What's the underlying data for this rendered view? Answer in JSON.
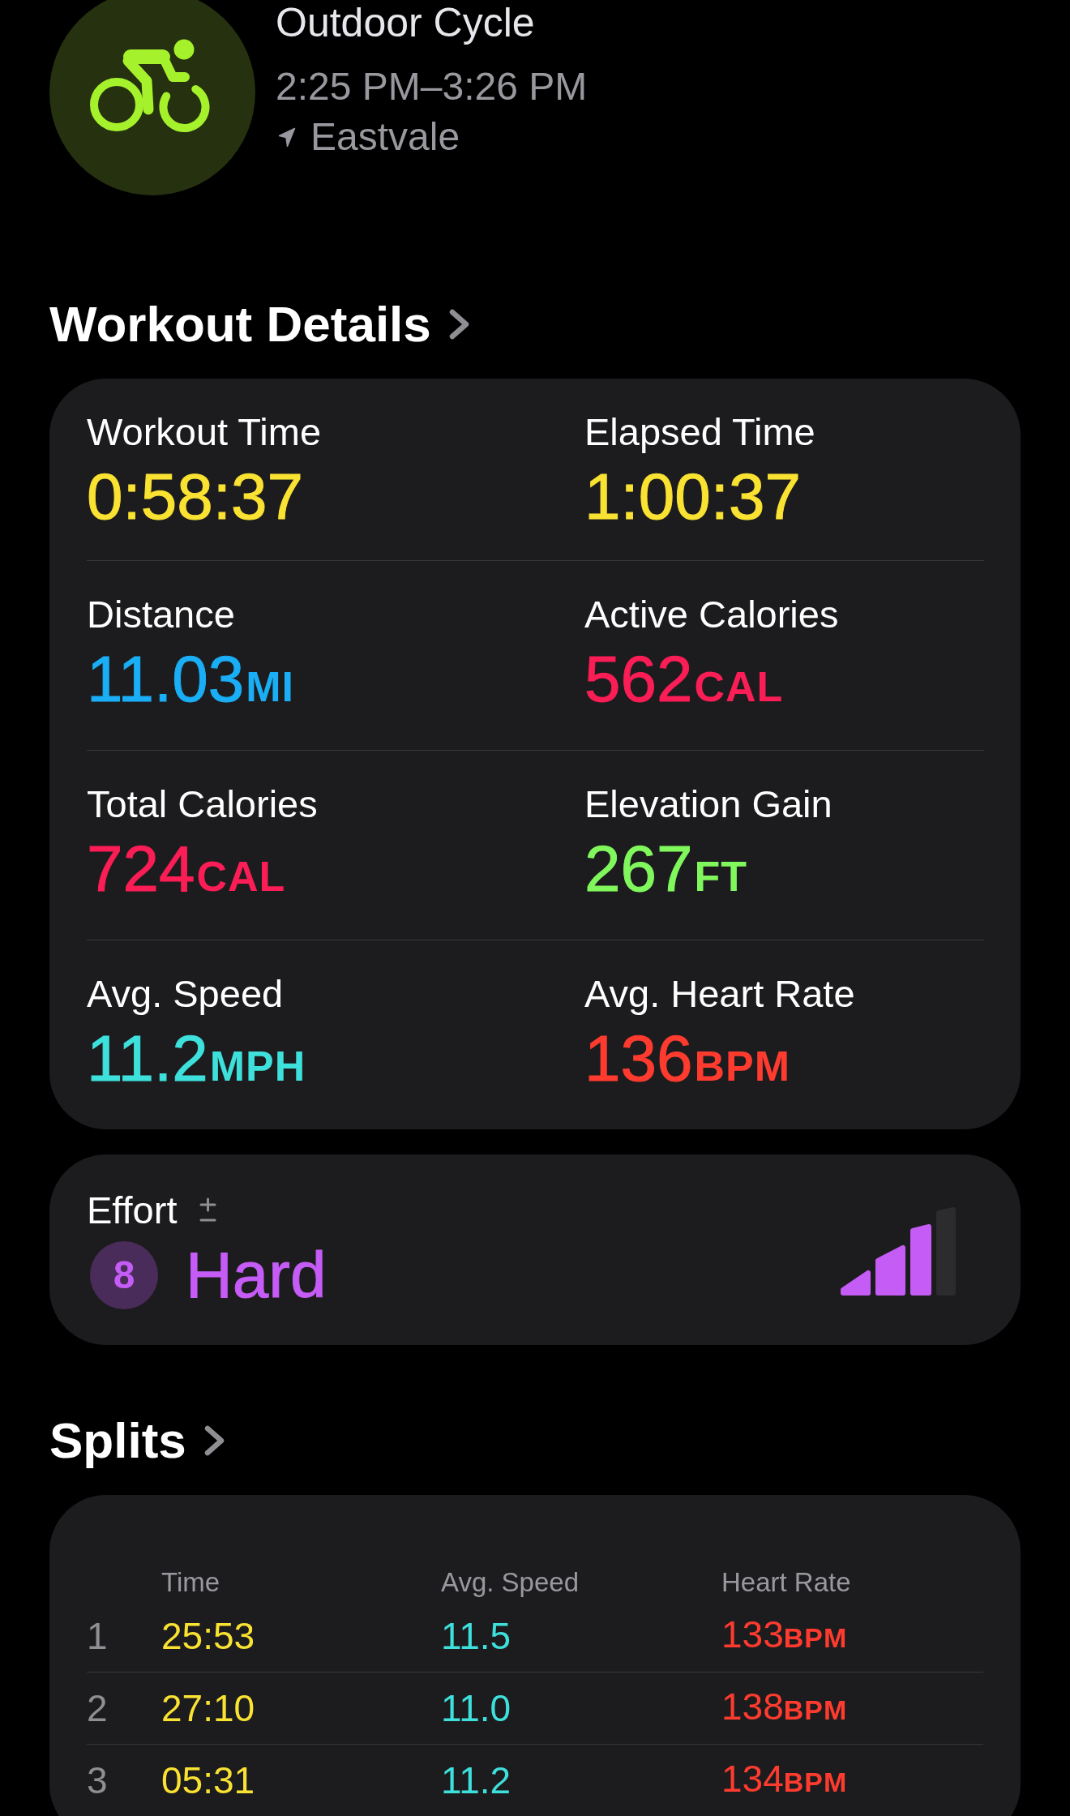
{
  "workout": {
    "title": "Outdoor Cycle",
    "time_range": "2:25 PM–3:26 PM",
    "location": "Eastvale"
  },
  "details": {
    "title": "Workout Details",
    "metrics": [
      {
        "label": "Workout Time",
        "value": "0:58:37",
        "color": "#fae232"
      },
      {
        "label": "Elapsed Time",
        "value": "1:00:37",
        "color": "#fae232"
      },
      {
        "label": "Distance",
        "value": "11.03",
        "unit": "MI",
        "color": "#19aef5"
      },
      {
        "label": "Active Calories",
        "value": "562",
        "unit": "CAL",
        "color": "#fb1d55"
      },
      {
        "label": "Total Calories",
        "value": "724",
        "unit": "CAL",
        "color": "#fb1d55"
      },
      {
        "label": "Elevation Gain",
        "value": "267",
        "unit": "FT",
        "color": "#80f75c"
      },
      {
        "label": "Avg. Speed",
        "value": "11.2",
        "unit": "MPH",
        "color": "#3ee0dc"
      },
      {
        "label": "Avg. Heart Rate",
        "value": "136",
        "unit": "BPM",
        "color": "#ff3b2f"
      }
    ]
  },
  "effort": {
    "label": "Effort",
    "score": "8",
    "rating": "Hard",
    "level": 0.75
  },
  "splits": {
    "title": "Splits",
    "columns": [
      "Time",
      "Avg. Speed",
      "Heart Rate"
    ],
    "rows": [
      {
        "index": "1",
        "time": "25:53",
        "speed": "11.5",
        "heart_rate": "133",
        "unit": "BPM"
      },
      {
        "index": "2",
        "time": "27:10",
        "speed": "11.0",
        "heart_rate": "138",
        "unit": "BPM"
      },
      {
        "index": "3",
        "time": "05:31",
        "speed": "11.2",
        "heart_rate": "134",
        "unit": "BPM"
      }
    ]
  }
}
